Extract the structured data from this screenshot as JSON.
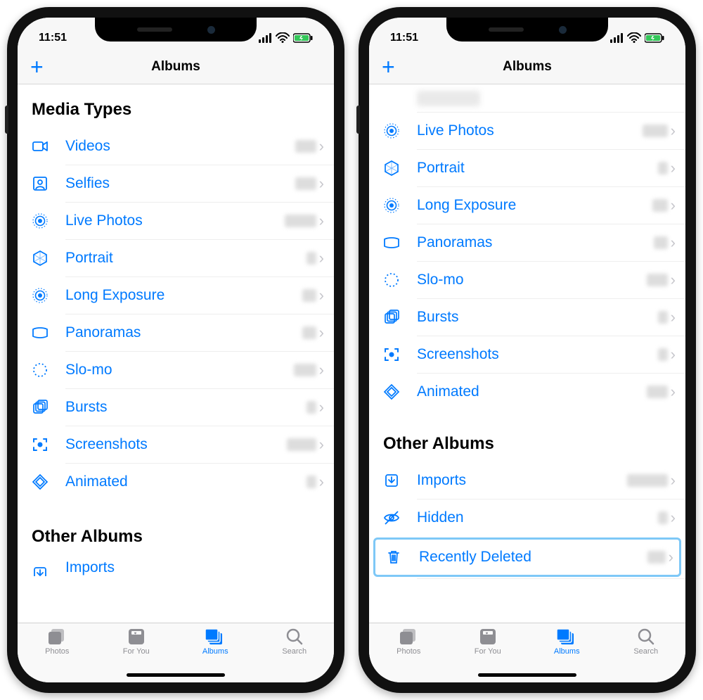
{
  "status": {
    "time": "11:51"
  },
  "nav": {
    "title": "Albums",
    "add": "+"
  },
  "sections": {
    "media_types": "Media Types",
    "other_albums": "Other Albums"
  },
  "media": {
    "videos": "Videos",
    "selfies": "Selfies",
    "live_photos": "Live Photos",
    "portrait": "Portrait",
    "long_exposure": "Long Exposure",
    "panoramas": "Panoramas",
    "slomo": "Slo-mo",
    "bursts": "Bursts",
    "screenshots": "Screenshots",
    "animated": "Animated"
  },
  "other": {
    "imports": "Imports",
    "hidden": "Hidden",
    "recently_deleted": "Recently Deleted"
  },
  "tabs": {
    "photos": "Photos",
    "for_you": "For You",
    "albums": "Albums",
    "search": "Search"
  }
}
